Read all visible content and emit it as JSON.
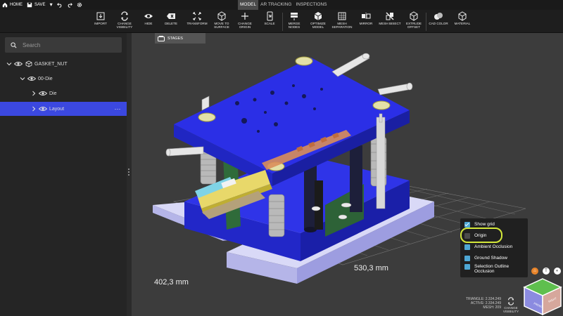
{
  "topbar": {
    "items": [
      {
        "label": "HOME",
        "icon": "home-icon"
      },
      {
        "label": "SAVE",
        "icon": "save-icon"
      },
      {
        "label": "",
        "icon": "caret-down-icon"
      },
      {
        "label": "",
        "icon": "undo-icon"
      },
      {
        "label": "",
        "icon": "redo-icon"
      },
      {
        "label": "",
        "icon": "settings-icon"
      }
    ],
    "modes": [
      {
        "label": "MODEL",
        "active": true
      },
      {
        "label": "AR TRACKING",
        "active": false
      },
      {
        "label": "INSPECTIONS",
        "active": false
      }
    ]
  },
  "toolbar": {
    "tools": [
      {
        "label": "Import",
        "icon": "import-icon"
      },
      {
        "label": "Change\nvisibility",
        "icon": "change-visibility-icon"
      },
      {
        "label": "Hide",
        "icon": "hide-icon"
      },
      {
        "label": "Delete",
        "icon": "delete-icon"
      },
      {
        "label": "Transform",
        "icon": "transform-icon"
      },
      {
        "label": "Move to\nsurface",
        "icon": "move-to-surface-icon"
      },
      {
        "label": "Change\norigin",
        "icon": "change-origin-icon"
      },
      {
        "label": "Scale",
        "icon": "scale-icon"
      },
      {
        "label": "Merge\nnodes",
        "icon": "merge-nodes-icon"
      },
      {
        "label": "Optimize\nmodel",
        "icon": "optimize-model-icon"
      },
      {
        "label": "Mesh\nseparation",
        "icon": "mesh-separation-icon"
      },
      {
        "label": "Mirror",
        "icon": "mirror-icon"
      },
      {
        "label": "Mesh bisect",
        "icon": "mesh-bisect-icon"
      },
      {
        "label": "Extrude\noffset",
        "icon": "extrude-offset-icon"
      },
      {
        "label": "CAD color",
        "icon": "cad-color-icon"
      },
      {
        "label": "Material",
        "icon": "material-icon"
      }
    ]
  },
  "sidebar": {
    "search_placeholder": "Search",
    "tree": [
      {
        "label": "GASKET_NUT",
        "expanded": true,
        "selected": false
      },
      {
        "label": "00-Die",
        "expanded": true,
        "selected": false
      },
      {
        "label": "Die",
        "expanded": false,
        "selected": false
      },
      {
        "label": "Layout",
        "expanded": false,
        "selected": true
      }
    ],
    "more_label": "⋯"
  },
  "viewport": {
    "stages_label": "STAGES",
    "dimension_width": "530,3 mm",
    "dimension_depth": "402,3 mm",
    "view_options": [
      {
        "label": "Show grid",
        "checked": true
      },
      {
        "label": "Origin",
        "checked": false
      },
      {
        "label": "Ambient Occlusion",
        "checked": false
      },
      {
        "label": "Ground Shadow",
        "checked": false
      },
      {
        "label": "Selection Outline\nOcclusion",
        "checked": false
      }
    ],
    "stats": {
      "triangle": "TRIANGLE: 2.334.249",
      "active": "ACTIVE: 2.334.249",
      "mesh": "MESH: 209"
    },
    "change_visibility_label": "CHANGE\nVISIBILITY",
    "nav_buttons": [
      {
        "label": "⌂",
        "color": "#e8842a"
      },
      {
        "label": "T",
        "color": "#ffffff"
      },
      {
        "label": "◐",
        "color": "#ffffff"
      }
    ],
    "cube_labels": {
      "front": "FRONT",
      "right": "RIGHT"
    }
  },
  "colors": {
    "accent": "#3b48e0",
    "die_blue": "#2b2fe6",
    "plate_lavender": "#c7c7f3",
    "highlight": "#d4e83a",
    "checkbox": "#4ea7d4"
  }
}
